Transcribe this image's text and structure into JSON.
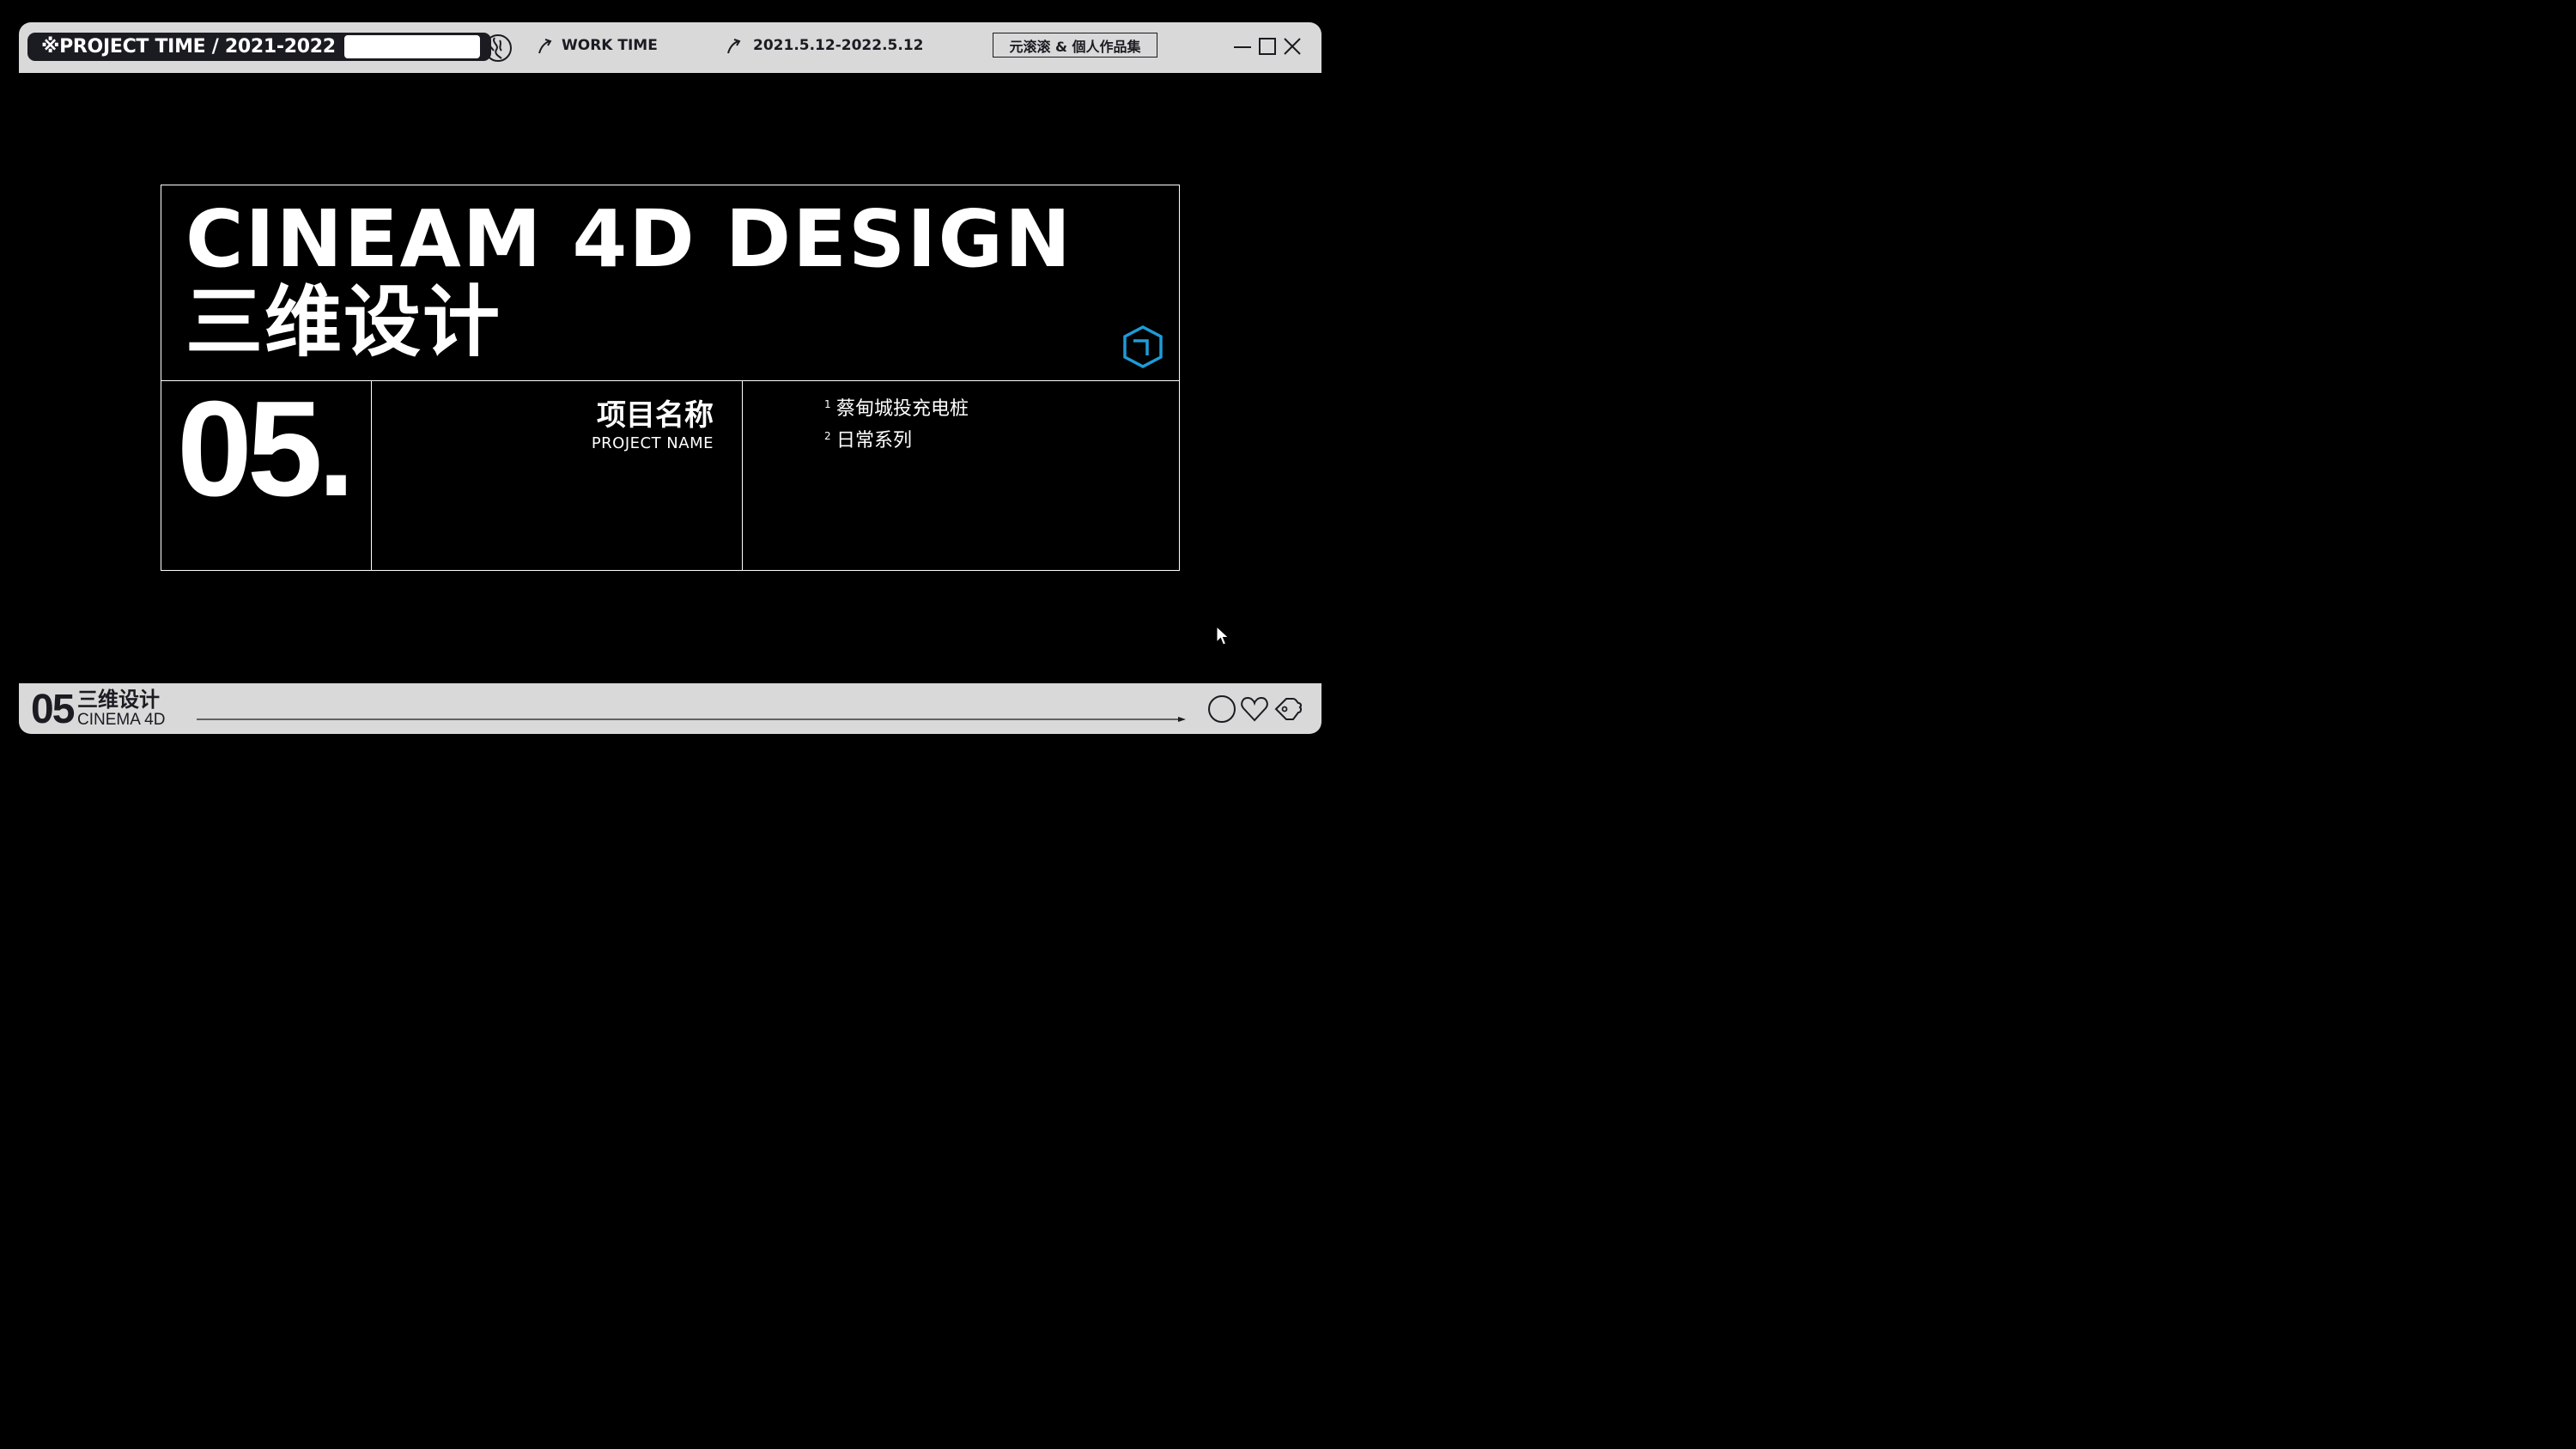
{
  "header": {
    "project_time_label": "※PROJECT TIME / 2021-2022",
    "search_value": "",
    "work_time_label": "WORK TIME",
    "date_range": "2021.5.12-2022.5.12",
    "portfolio_label": "元滚滚 & 個人作品集"
  },
  "icons": {
    "swirl": "swirl-icon",
    "arrow": "curved-arrow-icon",
    "minimize": "minimize-icon",
    "maximize": "maximize-icon",
    "close": "close-icon",
    "cube": "cube-logo-icon",
    "cursor": "cursor-icon",
    "circle": "circle-icon",
    "heart": "heart-icon",
    "tag": "tag-icon"
  },
  "main": {
    "title_en": "CINEAM 4D DESIGN",
    "title_cn": "三维设计",
    "number": "05.",
    "project_name_cn": "项目名称",
    "project_name_en": "PROJECT NAME",
    "projects": [
      {
        "num": "1",
        "name": "蔡甸城投充电桩"
      },
      {
        "num": "2",
        "name": "日常系列"
      }
    ]
  },
  "footer": {
    "number": "05",
    "title_cn": "三维设计",
    "title_en": "CINEMA 4D"
  },
  "colors": {
    "background": "#000000",
    "bar": "#d9d9d9",
    "dark": "#1b1c22",
    "accent": "#1e9bd7",
    "text": "#ffffff"
  }
}
